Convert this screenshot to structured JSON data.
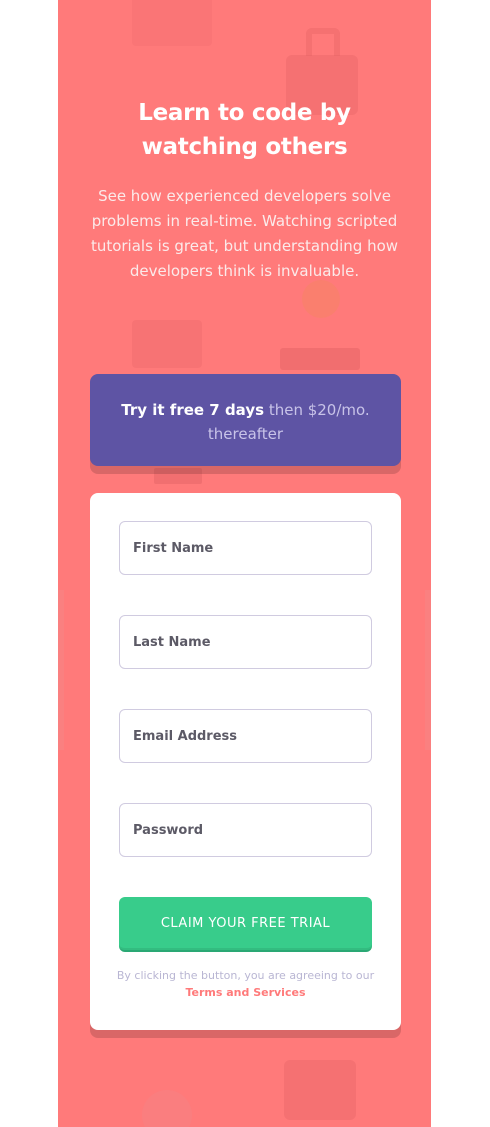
{
  "hero": {
    "title_line1": "Learn to code by",
    "title_line2": "watching others",
    "description": "See how experienced developers solve problems in real-time. Watching scripted tutorials is great, but understanding how developers think is invaluable."
  },
  "promo": {
    "bold": "Try it free 7 days",
    "rest": " then $20/mo. thereafter"
  },
  "form": {
    "first_name_placeholder": "First Name",
    "last_name_placeholder": "Last Name",
    "email_placeholder": "Email Address",
    "password_placeholder": "Password",
    "submit_label": "CLAIM YOUR FREE TRIAL",
    "terms_prefix": "By clicking the button, you are agreeing to our ",
    "terms_link": "Terms and Services"
  },
  "colors": {
    "background": "#ff7a7a",
    "promo": "#5e54a4",
    "cta": "#38cc8b",
    "link": "#ff7a7a"
  }
}
